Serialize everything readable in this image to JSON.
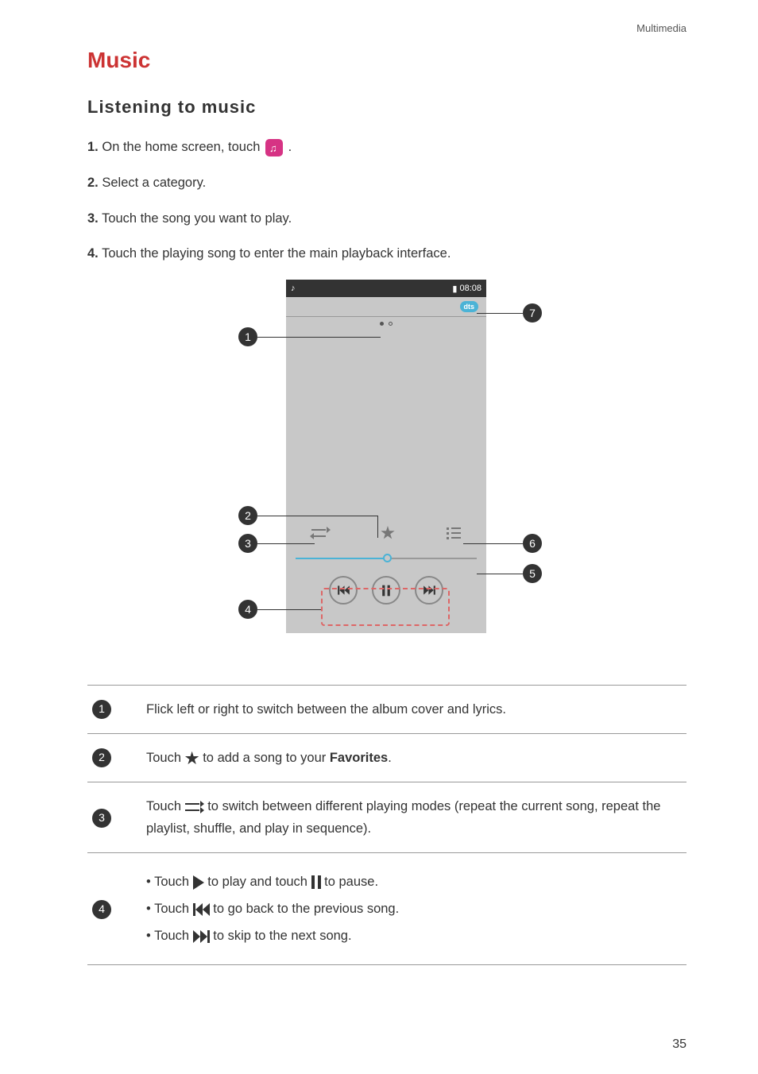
{
  "header": {
    "section": "Multimedia"
  },
  "title": "Music",
  "subtitle": "Listening to music",
  "steps": [
    {
      "num": "1.",
      "text_before": "On the home screen, touch ",
      "text_after": " ."
    },
    {
      "num": "2.",
      "text": "Select a category."
    },
    {
      "num": "3.",
      "text": "Touch the song you want to play."
    },
    {
      "num": "4.",
      "text": "Touch the playing song to enter the main playback interface."
    }
  ],
  "diagram": {
    "status_time": "08:08",
    "dts": "dts",
    "callouts": [
      "1",
      "2",
      "3",
      "4",
      "5",
      "6",
      "7"
    ]
  },
  "table": {
    "row1": "Flick left or right to switch between the album cover and lyrics.",
    "row2_before": "Touch ",
    "row2_after": " to add a song to your ",
    "row2_bold": "Favorites",
    "row2_end": ".",
    "row3_before": "Touch ",
    "row3_after": " to switch between different playing modes (repeat the current song, repeat the playlist, shuffle, and play in sequence).",
    "row4_l1_a": "Touch ",
    "row4_l1_b": " to play and touch ",
    "row4_l1_c": " to pause.",
    "row4_l2_a": "Touch ",
    "row4_l2_b": " to go back to the previous song.",
    "row4_l3_a": "Touch ",
    "row4_l3_b": " to skip to the next song."
  },
  "page": "35"
}
